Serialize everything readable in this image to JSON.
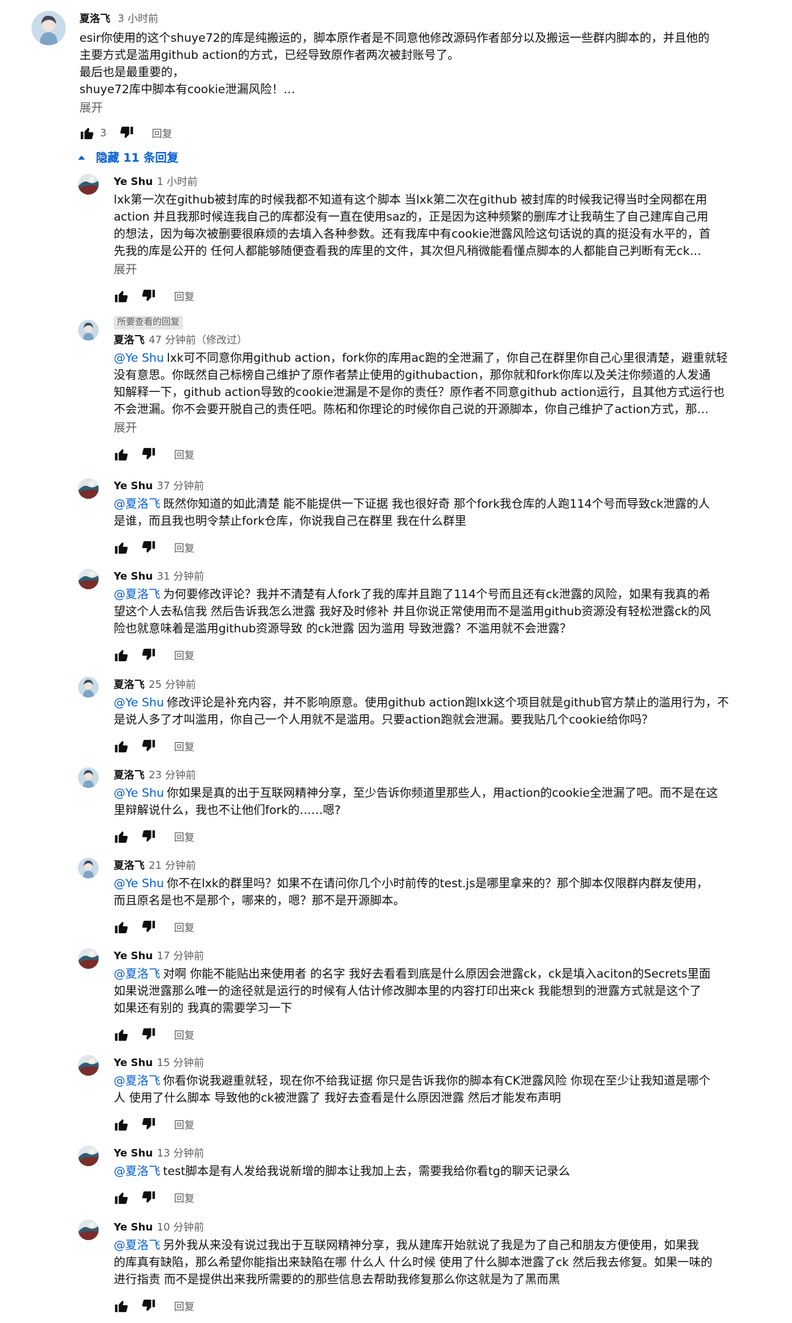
{
  "top_comment": {
    "author": "夏洛飞",
    "time": "3 小时前",
    "lines": [
      "esir你使用的这个shuye72的库是纯搬运的，脚本原作者是不同意他修改源码作者部分以及搬运一些群内脚本的，并且他的",
      "主要方式是滥用github action的方式，已经导致原作者两次被封账号了。",
      "最后也是最重要的，",
      "shuye72库中脚本有cookie泄漏风险！…"
    ],
    "expand_label": "展开",
    "like_count": "3",
    "reply_label": "回复"
  },
  "replies_toggle": "隐藏 11 条回复",
  "colors": {
    "link": "#065fd4",
    "secondary": "#606060"
  },
  "replies": [
    {
      "author": "Ye Shu",
      "time": "1 小时前",
      "avatar": "yeshu",
      "mention": "",
      "lines": [
        "lxk第一次在github被封库的时候我都不知道有这个脚本 当lxk第二次在github 被封库的时候我记得当时全网都在用",
        "action 并且我那时候连我自己的库都没有一直在使用saz的，正是因为这种频繁的删库才让我萌生了自己建库自己用",
        "的想法，因为每次被删要很麻烦的去填入各种参数。还有我库中有cookie泄露风险这句话说的真的挺没有水平的，首",
        "先我的库是公开的 任何人都能够随便查看我的库里的文件，其次但凡稍微能看懂点脚本的人都能自己判断有无ck…"
      ],
      "expand": "展开",
      "reply_label": "回复"
    },
    {
      "badge": "所要查看的回复",
      "author": "夏洛飞",
      "time": "47 分钟前（修改过）",
      "avatar": "xia",
      "mention": "@Ye Shu",
      "lines": [
        "lxk可不同意你用github action，fork你的库用ac跑的全泄漏了，你自己在群里你自己心里很清楚，避重就轻",
        "没有意思。你既然自己标榜自己维护了原作者禁止使用的githubaction，那你就和fork你库以及关注你频道的人发通",
        "知解释一下，github action导致的cookie泄漏是不是你的责任？原作者不同意github action运行，且其他方式运行也",
        "不会泄漏。你不会要开脱自己的责任吧。陈柘和你理论的时候你自己说的开源脚本，你自己维护了action方式，那…"
      ],
      "expand": "展开",
      "reply_label": "回复"
    },
    {
      "author": "Ye Shu",
      "time": "37 分钟前",
      "avatar": "yeshu",
      "mention": "@夏洛飞",
      "lines": [
        "既然你知道的如此清楚 能不能提供一下证据 我也很好奇 那个fork我仓库的人跑114个号而导致ck泄露的人",
        "是谁，而且我也明令禁止fork仓库，你说我自己在群里 我在什么群里"
      ],
      "reply_label": "回复"
    },
    {
      "author": "Ye Shu",
      "time": "31 分钟前",
      "avatar": "yeshu",
      "mention": "@夏洛飞",
      "lines": [
        "为何要修改评论？我并不清楚有人fork了我的库并且跑了114个号而且还有ck泄露的风险，如果有我真的希",
        "望这个人去私信我 然后告诉我怎么泄露 我好及时修补 并且你说正常使用而不是滥用github资源没有轻松泄露ck的风",
        "险也就意味着是滥用github资源导致 的ck泄露 因为滥用 导致泄露？不滥用就不会泄露？"
      ],
      "reply_label": "回复"
    },
    {
      "author": "夏洛飞",
      "time": "25 分钟前",
      "avatar": "xia",
      "mention": "@Ye Shu",
      "lines": [
        "修改评论是补充内容，并不影响原意。使用github action跑lxk这个项目就是github官方禁止的滥用行为，不",
        "是说人多了才叫滥用，你自己一个人用就不是滥用。只要action跑就会泄漏。要我贴几个cookie给你吗？"
      ],
      "reply_label": "回复"
    },
    {
      "author": "夏洛飞",
      "time": "23 分钟前",
      "avatar": "xia",
      "mention": "@Ye Shu",
      "lines": [
        "你如果是真的出于互联网精神分享，至少告诉你频道里那些人，用action的cookie全泄漏了吧。而不是在这",
        "里辩解说什么，我也不让他们fork的……嗯?"
      ],
      "reply_label": "回复"
    },
    {
      "author": "夏洛飞",
      "time": "21 分钟前",
      "avatar": "xia",
      "mention": "@Ye Shu",
      "lines": [
        "你不在lxk的群里吗？如果不在请问你几个小时前传的test.js是哪里拿来的？那个脚本仅限群内群友使用，",
        "而且原名是也不是那个，哪来的，嗯？那不是开源脚本。"
      ],
      "reply_label": "回复"
    },
    {
      "author": "Ye Shu",
      "time": "17 分钟前",
      "avatar": "yeshu",
      "mention": "@夏洛飞",
      "lines": [
        "对啊 你能不能贴出来使用者 的名字 我好去看看到底是什么原因会泄露ck，ck是填入aciton的Secrets里面",
        "如果说泄露那么唯一的途径就是运行的时候有人估计修改脚本里的内容打印出来ck 我能想到的泄露方式就是这个了",
        "如果还有别的 我真的需要学习一下"
      ],
      "reply_label": "回复"
    },
    {
      "author": "Ye Shu",
      "time": "15 分钟前",
      "avatar": "yeshu",
      "mention": "@夏洛飞",
      "lines": [
        "你看你说我避重就轻，现在你不给我证据 你只是告诉我你的脚本有CK泄露风险 你现在至少让我知道是哪个",
        "人 使用了什么脚本 导致他的ck被泄露了 我好去查看是什么原因泄露 然后才能发布声明"
      ],
      "reply_label": "回复"
    },
    {
      "author": "Ye Shu",
      "time": "13 分钟前",
      "avatar": "yeshu",
      "mention": "@夏洛飞",
      "lines": [
        "test脚本是有人发给我说新增的脚本让我加上去，需要我给你看tg的聊天记录么"
      ],
      "reply_label": "回复"
    },
    {
      "author": "Ye Shu",
      "time": "10 分钟前",
      "avatar": "yeshu",
      "mention": "@夏洛飞",
      "lines": [
        "另外我从来没有说过我出于互联网精神分享，我从建库开始就说了我是为了自己和朋友方便使用，如果我",
        "的库真有缺陷，那么希望你能指出来缺陷在哪 什么人 什么时候 使用了什么脚本泄露了ck 然后我去修复。如果一味的",
        "进行指责 而不是提供出来我所需要的的那些信息去帮助我修复那么你这就是为了黑而黑"
      ],
      "reply_label": "回复"
    }
  ]
}
